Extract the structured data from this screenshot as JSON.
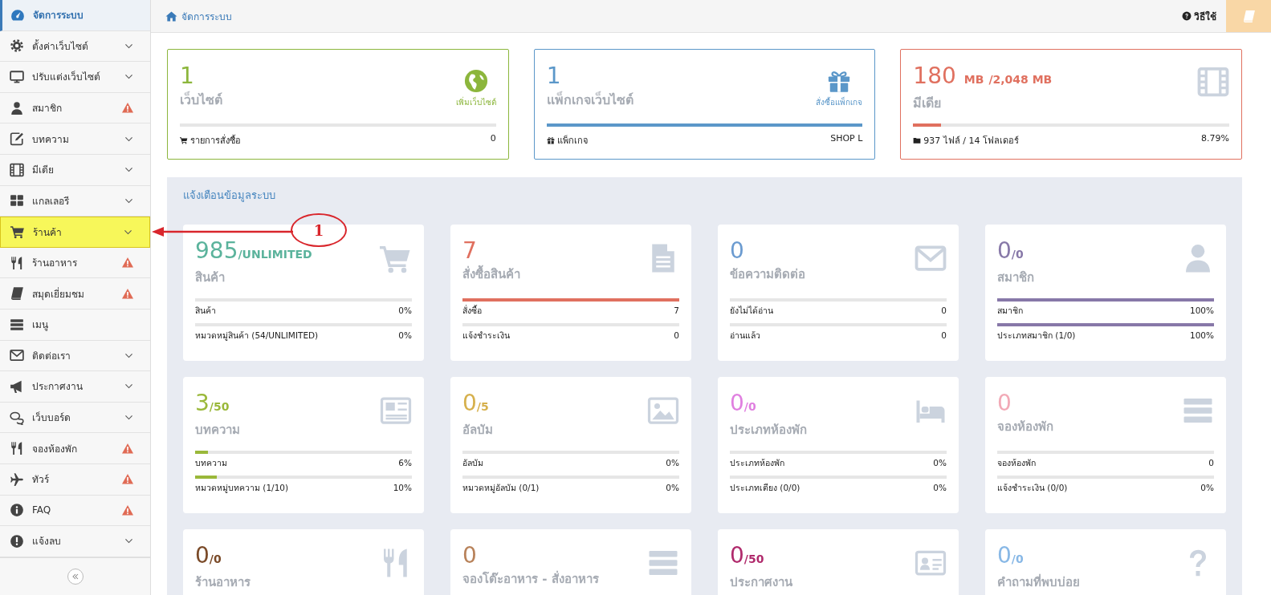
{
  "breadcrumb": {
    "label": "จัดการระบบ"
  },
  "help": {
    "label": "วิธีใช้"
  },
  "sidebar": {
    "items": [
      {
        "label": "จัดการระบบ",
        "selected": true,
        "highlighted": false,
        "expandable": false,
        "warning": false
      },
      {
        "label": "ตั้งค่าเว็บไซต์",
        "selected": false,
        "highlighted": false,
        "expandable": true,
        "warning": false
      },
      {
        "label": "ปรับแต่งเว็บไซต์",
        "selected": false,
        "highlighted": false,
        "expandable": true,
        "warning": false
      },
      {
        "label": "สมาชิก",
        "selected": false,
        "highlighted": false,
        "expandable": false,
        "warning": true
      },
      {
        "label": "บทความ",
        "selected": false,
        "highlighted": false,
        "expandable": true,
        "warning": false
      },
      {
        "label": "มีเดีย",
        "selected": false,
        "highlighted": false,
        "expandable": true,
        "warning": false
      },
      {
        "label": "แกลเลอรี",
        "selected": false,
        "highlighted": false,
        "expandable": true,
        "warning": false
      },
      {
        "label": "ร้านค้า",
        "selected": false,
        "highlighted": true,
        "expandable": true,
        "warning": false
      },
      {
        "label": "ร้านอาหาร",
        "selected": false,
        "highlighted": false,
        "expandable": false,
        "warning": true
      },
      {
        "label": "สมุดเยี่ยมชม",
        "selected": false,
        "highlighted": false,
        "expandable": false,
        "warning": true
      },
      {
        "label": "เมนู",
        "selected": false,
        "highlighted": false,
        "expandable": false,
        "warning": false
      },
      {
        "label": "ติดต่อเรา",
        "selected": false,
        "highlighted": false,
        "expandable": true,
        "warning": false
      },
      {
        "label": "ประกาศงาน",
        "selected": false,
        "highlighted": false,
        "expandable": true,
        "warning": false
      },
      {
        "label": "เว็บบอร์ด",
        "selected": false,
        "highlighted": false,
        "expandable": true,
        "warning": false
      },
      {
        "label": "จองห้องพัก",
        "selected": false,
        "highlighted": false,
        "expandable": false,
        "warning": true
      },
      {
        "label": "ทัวร์",
        "selected": false,
        "highlighted": false,
        "expandable": false,
        "warning": true
      },
      {
        "label": "FAQ",
        "selected": false,
        "highlighted": false,
        "expandable": false,
        "warning": true
      },
      {
        "label": "แจ้งลบ",
        "selected": false,
        "highlighted": false,
        "expandable": true,
        "warning": false
      }
    ]
  },
  "summary_cards": [
    {
      "value": "1",
      "label": "เว็บไซต์",
      "action": "เพิ่มเว็บไซต์",
      "color": "#8cb63c",
      "level": 0,
      "footer_label": "รายการสั่งซื้อ",
      "footer_value": "0"
    },
    {
      "value": "1",
      "label": "แพ็กเกจเว็บไซต์",
      "action": "สั่งซื้อแพ็กเกจ",
      "color": "#5b97c9",
      "level": 1,
      "footer_label": "แพ็กเกจ",
      "footer_value": "SHOP L"
    },
    {
      "value": "180",
      "unit": "MB",
      "total": "/2,048 MB",
      "label": "มีเดีย",
      "color": "#e0705f",
      "level": 0.0879,
      "footer_label": "937 ไฟล์ / 14 โฟลเดอร์",
      "footer_value": "8.79%"
    }
  ],
  "alerts": {
    "title": "แจ้งเตือนข้อมูลระบบ",
    "widgets": [
      {
        "value": "985",
        "suffix": "/UNLIMITED",
        "label": "สินค้า",
        "color": "#5bb39c",
        "rows": [
          {
            "label": "สินค้า",
            "value": "0%",
            "level": 0
          },
          {
            "label": "หมวดหมู่สินค้า (54/UNLIMITED)",
            "value": "0%",
            "level": 0
          }
        ]
      },
      {
        "value": "7",
        "label": "สั่งซื้อสินค้า",
        "color": "#e0705f",
        "rows": [
          {
            "label": "สั่งซื้อ",
            "value": "7",
            "level": 1
          },
          {
            "label": "แจ้งชำระเงิน",
            "value": "0",
            "level": 0
          }
        ]
      },
      {
        "value": "0",
        "label": "ข้อความติดต่อ",
        "color": "#6b9bd0",
        "rows": [
          {
            "label": "ยังไม่ได้อ่าน",
            "value": "0",
            "level": 0
          },
          {
            "label": "อ่านแล้ว",
            "value": "0",
            "level": 0
          }
        ]
      },
      {
        "value": "0",
        "suffix": "/0",
        "label": "สมาชิก",
        "color": "#8778a8",
        "rows": [
          {
            "label": "สมาชิก",
            "value": "100%",
            "level": 1
          },
          {
            "label": "ประเภทสมาชิก (1/0)",
            "value": "100%",
            "level": 1
          }
        ]
      },
      {
        "value": "3",
        "suffix": "/50",
        "label": "บทความ",
        "color": "#9ab83a",
        "rows": [
          {
            "label": "บทความ",
            "value": "6%",
            "level": 0.06
          },
          {
            "label": "หมวดหมู่บทความ (1/10)",
            "value": "10%",
            "level": 0.1
          }
        ]
      },
      {
        "value": "0",
        "suffix": "/5",
        "label": "อัลบัม",
        "color": "#d6b04c",
        "rows": [
          {
            "label": "อัลบัม",
            "value": "0%",
            "level": 0
          },
          {
            "label": "หมวดหมู่อัลบัม (0/1)",
            "value": "0%",
            "level": 0
          }
        ]
      },
      {
        "value": "0",
        "suffix": "/0",
        "label": "ประเภทห้องพัก",
        "color": "#e07fe0",
        "rows": [
          {
            "label": "ประเภทห้องพัก",
            "value": "0%",
            "level": 0
          },
          {
            "label": "ประเภทเตียง (0/0)",
            "value": "0%",
            "level": 0
          }
        ]
      },
      {
        "value": "0",
        "label": "จองห้องพัก",
        "color": "#f2a9b6",
        "rows": [
          {
            "label": "จองห้องพัก",
            "value": "0",
            "level": 0
          },
          {
            "label": "แจ้งชำระเงิน (0/0)",
            "value": "0%",
            "level": 0
          }
        ]
      },
      {
        "value": "0",
        "suffix": "/0",
        "label": "ร้านอาหาร",
        "color": "#7a4a28"
      },
      {
        "value": "0",
        "label": "จองโต๊ะอาหาร - สั่งอาหาร",
        "color": "#b8825a"
      },
      {
        "value": "0",
        "suffix": "/50",
        "label": "ประกาศงาน",
        "color": "#b02a6c"
      },
      {
        "value": "0",
        "suffix": "/0",
        "label": "คำถามที่พบบ่อย",
        "color": "#88b8e6"
      }
    ]
  },
  "annotation": {
    "label": "1"
  }
}
